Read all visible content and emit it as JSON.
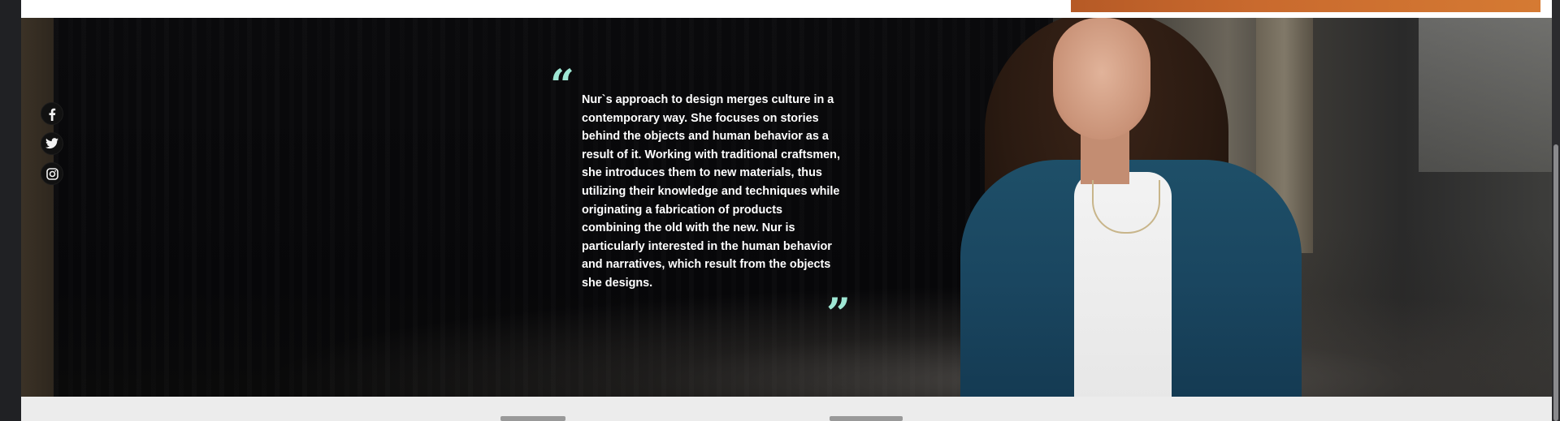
{
  "hero": {
    "quote": {
      "open_mark": "“",
      "close_mark": "”",
      "text": "Nur`s approach to design merges culture in a contemporary way. She focuses on stories behind the objects and human behavior as a result of it. Working with traditional craftsmen, she introduces them to new materials, thus utilizing their knowledge and techniques while originating a fabrication of products combining the old with the new. Nur is particularly interested in the human behavior and narratives, which result from the objects she designs."
    },
    "social": [
      {
        "name": "facebook-icon",
        "glyph": "f"
      },
      {
        "name": "twitter-icon",
        "glyph": "twitter"
      },
      {
        "name": "instagram-icon",
        "glyph": "instagram"
      }
    ]
  },
  "colors": {
    "quote_mark": "#9fe7d4",
    "top_banner_accent": "#c96a2e",
    "page_bg": "#202124",
    "content_bg": "#ececec"
  }
}
